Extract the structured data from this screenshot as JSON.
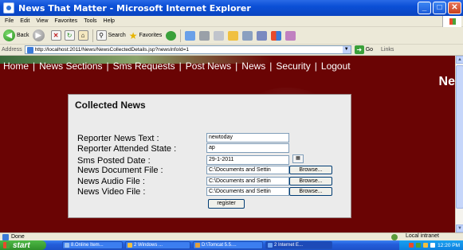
{
  "window": {
    "title": "News That Matter - Microsoft Internet Explorer",
    "buttons": {
      "minimize": "_",
      "maximize": "□",
      "close": "✕"
    }
  },
  "menu": [
    "File",
    "Edit",
    "View",
    "Favorites",
    "Tools",
    "Help"
  ],
  "toolbar": {
    "back_label": "Back",
    "search_label": "Search",
    "favorites_label": "Favorites"
  },
  "address": {
    "label": "Address",
    "url": "http://localhost:2011/News/NewsCollectedDetails.jsp?newsInfoId=1",
    "go_label": "Go",
    "links_label": "Links"
  },
  "nav": {
    "items": [
      "Home",
      "News Sections",
      "Sms Requests",
      "Post News",
      "News",
      "Security",
      "Logout"
    ],
    "pipe": "|",
    "banner_right": "Ne"
  },
  "form": {
    "title": "Collected News",
    "fields": {
      "reporter_text_label": "Reporter News Text :",
      "reporter_text_value": "newtoday",
      "attended_state_label": "Reporter Attended State :",
      "attended_state_value": "ap",
      "posted_date_label": "Sms Posted Date :",
      "posted_date_value": "29-1-2011",
      "document_file_label": "News Document File :",
      "document_file_value": "C:\\Documents and Settin",
      "audio_file_label": "News Audio File :",
      "audio_file_value": "C:\\Documents and Settin",
      "video_file_label": "News Video File :",
      "video_file_value": "C:\\Documents and Settin"
    },
    "browse_label": "Browse...",
    "register_label": "register",
    "calendar_glyph": "▦"
  },
  "status": {
    "text": "Done",
    "zone": "Local intranet"
  },
  "taskbar": {
    "start_label": "start",
    "tasks": [
      "8.Online Item...",
      "2 Windows ...",
      "D:\\Tomcat 5.5....",
      "2 Internet E..."
    ],
    "clock": "12:20 PM"
  },
  "colors": {
    "page_bg": "#6a0404",
    "panel_bg": "#ebebeb",
    "titlebar": "#0b4fd6",
    "taskbar": "#245edb",
    "start_button": "#3b9b33"
  }
}
